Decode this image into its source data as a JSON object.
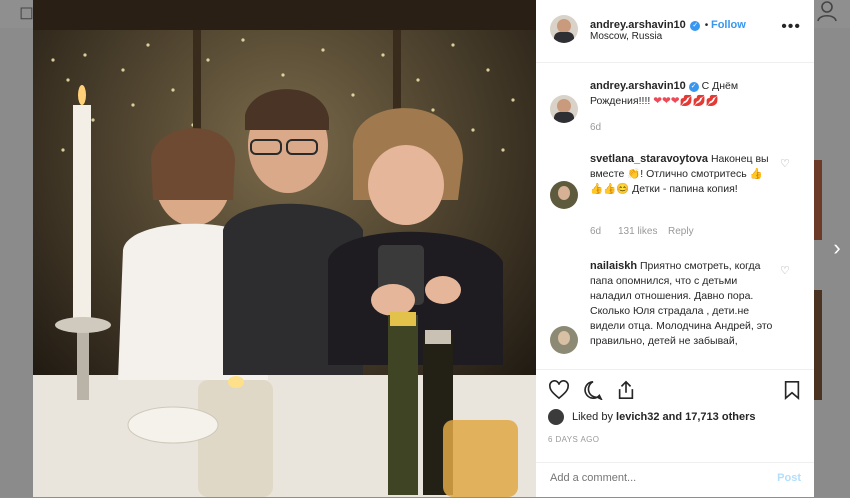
{
  "post": {
    "username": "andrey.arshavin10",
    "follow_label": "Follow",
    "location": "Moscow, Russia",
    "more_label": "•••"
  },
  "caption": {
    "username": "andrey.arshavin10",
    "text": "С Днём Рождения!!!!",
    "emojis": "❤❤❤💋💋💋",
    "time": "6d"
  },
  "comments": [
    {
      "username": "svetlana_staravoytova",
      "text": "Наконец вы вместе 👏! Отлично смотритесь 👍👍👍😊 Детки - папина копия!",
      "time": "6d",
      "likes": "131 likes",
      "reply": "Reply"
    },
    {
      "username": "nailaiskh",
      "text": "Приятно смотреть, когда папа опомнился, что с детьми наладил отношения. Давно пора. Сколько Юля страдала , дети.не видели отца. Молодчина Андрей, это правильно, детей не забывай,"
    }
  ],
  "likes": {
    "prefix": "Liked by",
    "user": "levich32",
    "suffix": "and 17,713 others"
  },
  "date": "6 DAYS AGO",
  "add_comment": {
    "placeholder": "Add a comment...",
    "post_label": "Post"
  },
  "colors": {
    "link_blue": "#3897f0",
    "post_disabled": "#b2dffc",
    "heart_red": "#ed4956"
  },
  "icons": [
    "verified-badge-icon",
    "more-icon",
    "heart-icon",
    "comment-icon",
    "share-icon",
    "bookmark-icon",
    "next-arrow-icon",
    "profile-icon"
  ]
}
